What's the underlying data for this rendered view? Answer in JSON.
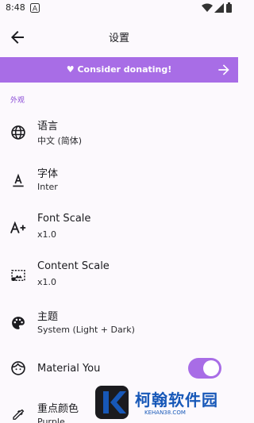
{
  "status_bar": {
    "time": "8:48",
    "notification_icon": "a-icon"
  },
  "app_bar": {
    "title": "设置",
    "back_icon": "arrow-left-icon"
  },
  "donate_banner": {
    "label": "♥ Consider donating!",
    "arrow_icon": "arrow-right-icon"
  },
  "section": {
    "title": "外观"
  },
  "items": [
    {
      "title": "语言",
      "value": "中文 (简体)",
      "icon": "globe-icon"
    },
    {
      "title": "字体",
      "value": "Inter",
      "icon": "font-icon"
    },
    {
      "title": "Font Scale",
      "value": "x1.0",
      "icon": "text-increase-icon"
    },
    {
      "title": "Content Scale",
      "value": "x1.0",
      "icon": "fit-screen-icon"
    },
    {
      "title": "主题",
      "value": "System (Light + Dark)",
      "icon": "palette-icon"
    },
    {
      "title": "Material You",
      "icon": "face-icon",
      "toggle_on": true
    },
    {
      "title": "重点颜色",
      "value": "Purple",
      "icon": "colorize-icon"
    }
  ],
  "watermark": {
    "text": "柯翰软件园",
    "sub": "KEHAN38.COM"
  },
  "colors": {
    "accent": "#a86de6",
    "section": "#8a4bd6",
    "background": "#fcf9fd"
  }
}
